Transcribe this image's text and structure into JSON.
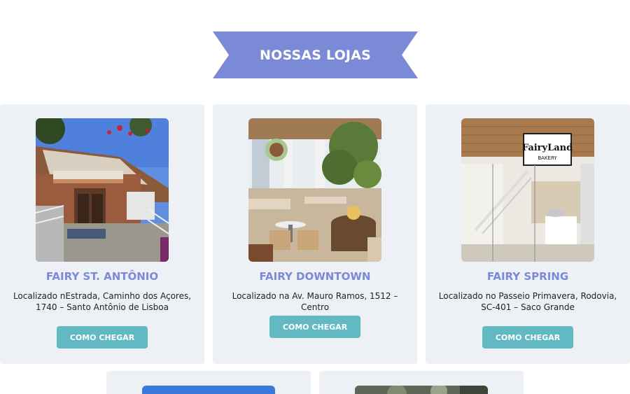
{
  "section": {
    "title": "NOSSAS LOJAS",
    "banner_color": "#7b8ad6"
  },
  "stores": [
    {
      "name": "FAIRY ST. ANTÔNIO",
      "address": "Localizado nEstrada, Caminho dos Açores, 1740 – Santo Antônio de Lisboa",
      "button_label": "COMO CHEGAR"
    },
    {
      "name": "FAIRY DOWNTOWN",
      "address": "Localizado na Av. Mauro Ramos, 1512 – Centro",
      "button_label": "COMO CHEGAR"
    },
    {
      "name": "FAIRY SPRING",
      "address": "Localizado no Passeio Primavera, Rodovia, SC-401 – Saco Grande",
      "button_label": "COMO CHEGAR",
      "sign_title": "FairyLand",
      "sign_subtitle": "BAKERY"
    }
  ],
  "colors": {
    "card_bg": "#edf0f5",
    "accent": "#7b8ad6",
    "button": "#62b9c3"
  }
}
